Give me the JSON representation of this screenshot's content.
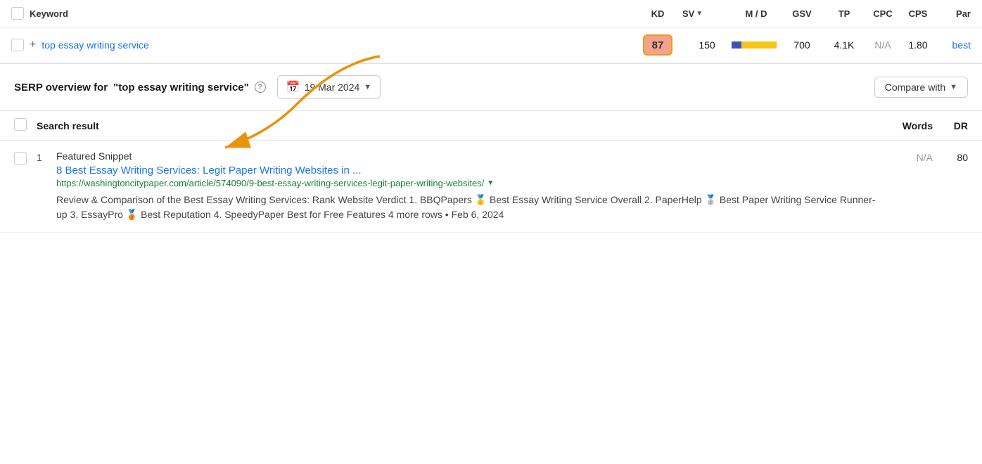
{
  "table": {
    "columns": {
      "keyword": "Keyword",
      "kd": "KD",
      "sv": "SV",
      "md": "M / D",
      "gsv": "GSV",
      "tp": "TP",
      "cpc": "CPC",
      "cps": "CPS",
      "pare": "Par"
    },
    "row": {
      "keyword": "top essay writing service",
      "kd_value": "87",
      "sv_value": "150",
      "gsv_value": "700",
      "tp_value": "4.1K",
      "cpc_value": "N/A",
      "cps_value": "1.80",
      "pare_value": "best"
    }
  },
  "serp": {
    "title_prefix": "SERP overview for ",
    "keyword_quoted": "\"top essay writing service\"",
    "date_label": "19 Mar 2024",
    "compare_label": "Compare with"
  },
  "results_table": {
    "col_search_result": "Search result",
    "col_words": "Words",
    "col_dr": "DR",
    "row": {
      "rank": "1",
      "featured_label": "Featured Snippet",
      "title": "8 Best Essay Writing Services: Legit Paper Writing Websites in ...",
      "url": "https://washingtoncitypaper.com/article/574090/9-best-essay-writing-services-legit-paper-writing-websites/",
      "snippet": "Review & Comparison of the Best Essay Writing Services: Rank Website Verdict 1. BBQPapers 🥇 Best Essay Writing Service Overall 2. PaperHelp 🥈 Best Paper Writing Service Runner-up 3. EssayPro 🥉 Best Reputation 4. SpeedyPaper Best for Free Features 4 more rows • Feb 6, 2024",
      "words": "N/A",
      "dr": "80"
    }
  }
}
